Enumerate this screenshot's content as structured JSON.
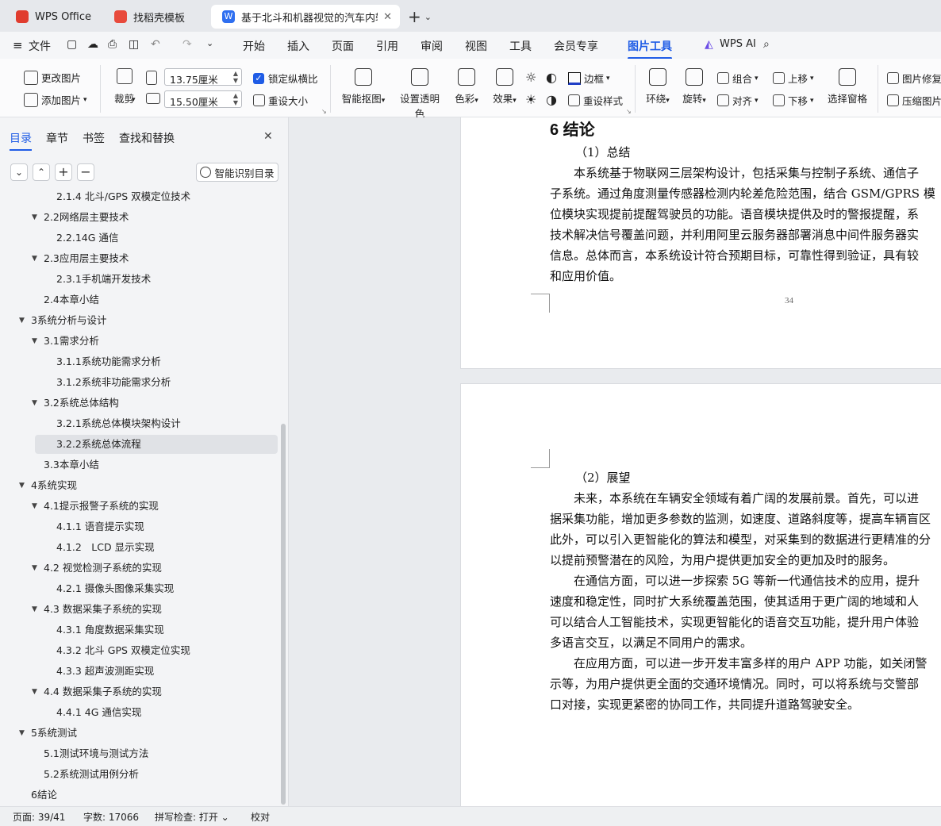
{
  "tabs": [
    {
      "label": "WPS Office"
    },
    {
      "label": "找稻壳模板"
    },
    {
      "label": "基于北斗和机器视觉的汽车内轮"
    }
  ],
  "menu": {
    "file": "文件",
    "items": [
      "开始",
      "插入",
      "页面",
      "引用",
      "审阅",
      "视图",
      "工具",
      "会员专享",
      "图片工具"
    ],
    "ai": "WPS AI"
  },
  "ribbon": {
    "change_pic": "更改图片",
    "add_pic": "添加图片",
    "crop": "裁剪",
    "width": "13.75厘米",
    "height": "15.50厘米",
    "lock_ratio": "锁定纵横比",
    "reset_size": "重设大小",
    "smart_cutout": "智能抠图",
    "set_transparent": "设置透明色",
    "color": "色彩",
    "effect": "效果",
    "border": "边框",
    "reset_style": "重设样式",
    "wrap": "环绕",
    "rotate": "旋转",
    "group": "组合",
    "align": "对齐",
    "bring_forward": "上移",
    "send_backward": "下移",
    "select_pane": "选择窗格",
    "repair": "图片修复",
    "compress": "压缩图片"
  },
  "sidebar": {
    "tabs": [
      "目录",
      "章节",
      "书签",
      "查找和替换"
    ],
    "smart_btn": "智能识别目录",
    "toc": [
      {
        "text": "2.1.4 北斗/GPS 双模定位技术",
        "level": 3,
        "arrow": ""
      },
      {
        "text": "2.2网络层主要技术",
        "level": 2,
        "arrow": "▼"
      },
      {
        "text": "2.2.14G 通信",
        "level": 3,
        "arrow": ""
      },
      {
        "text": "2.3应用层主要技术",
        "level": 2,
        "arrow": "▼"
      },
      {
        "text": "2.3.1手机端开发技术",
        "level": 3,
        "arrow": ""
      },
      {
        "text": "2.4本章小结",
        "level": 2,
        "arrow": ""
      },
      {
        "text": "3系统分析与设计",
        "level": 1,
        "arrow": "▼"
      },
      {
        "text": "3.1需求分析",
        "level": 2,
        "arrow": "▼"
      },
      {
        "text": "3.1.1系统功能需求分析",
        "level": 3,
        "arrow": ""
      },
      {
        "text": "3.1.2系统非功能需求分析",
        "level": 3,
        "arrow": ""
      },
      {
        "text": "3.2系统总体结构",
        "level": 2,
        "arrow": "▼"
      },
      {
        "text": "3.2.1系统总体模块架构设计",
        "level": 3,
        "arrow": ""
      },
      {
        "text": "3.2.2系统总体流程",
        "level": 3,
        "arrow": "",
        "selected": true
      },
      {
        "text": "3.3本章小结",
        "level": 2,
        "arrow": ""
      },
      {
        "text": "4系统实现",
        "level": 1,
        "arrow": "▼"
      },
      {
        "text": "4.1提示报警子系统的实现",
        "level": 2,
        "arrow": "▼"
      },
      {
        "text": "4.1.1 语音提示实现",
        "level": 3,
        "arrow": ""
      },
      {
        "text": "4.1.2　LCD 显示实现",
        "level": 3,
        "arrow": ""
      },
      {
        "text": "4.2 视觉检测子系统的实现",
        "level": 2,
        "arrow": "▼"
      },
      {
        "text": "4.2.1 摄像头图像采集实现",
        "level": 3,
        "arrow": ""
      },
      {
        "text": "4.3 数据采集子系统的实现",
        "level": 2,
        "arrow": "▼"
      },
      {
        "text": "4.3.1 角度数据采集实现",
        "level": 3,
        "arrow": ""
      },
      {
        "text": "4.3.2 北斗 GPS 双模定位实现",
        "level": 3,
        "arrow": ""
      },
      {
        "text": "4.3.3 超声波测距实现",
        "level": 3,
        "arrow": ""
      },
      {
        "text": "4.4 数据采集子系统的实现",
        "level": 2,
        "arrow": "▼"
      },
      {
        "text": "4.4.1 4G 通信实现",
        "level": 3,
        "arrow": ""
      },
      {
        "text": "5系统测试",
        "level": 1,
        "arrow": "▼"
      },
      {
        "text": "5.1测试环境与测试方法",
        "level": 2,
        "arrow": ""
      },
      {
        "text": "5.2系统测试用例分析",
        "level": 2,
        "arrow": ""
      },
      {
        "text": "6结论",
        "level": 1,
        "arrow": ""
      }
    ]
  },
  "doc": {
    "heading": "6  结论",
    "page_number": "34",
    "page1": [
      "（1）总结",
      "本系统基于物联网三层架构设计，包括采集与控制子系统、通信子",
      "子系统。通过角度测量传感器检测内轮差危险范围，结合 GSM/GPRS 模",
      "位模块实现提前提醒驾驶员的功能。语音模块提供及时的警报提醒，系",
      "技术解决信号覆盖问题，并利用阿里云服务器部署消息中间件服务器实",
      "信息。总体而言，本系统设计符合预期目标，可靠性得到验证，具有较",
      "和应用价值。"
    ],
    "page2": [
      "（2）展望",
      "未来，本系统在车辆安全领域有着广阔的发展前景。首先，可以进",
      "据采集功能，增加更多参数的监测，如速度、道路斜度等，提高车辆盲区",
      "此外，可以引入更智能化的算法和模型，对采集到的数据进行更精准的分",
      "以提前预警潜在的风险，为用户提供更加安全的更加及时的服务。",
      "在通信方面，可以进一步探索 5G 等新一代通信技术的应用，提升",
      "速度和稳定性，同时扩大系统覆盖范围，使其适用于更广阔的地域和人",
      "可以结合人工智能技术，实现更智能化的语音交互功能，提升用户体验",
      "多语言交互，以满足不同用户的需求。",
      "在应用方面，可以进一步开发丰富多样的用户 APP 功能，如关闭警",
      "示等，为用户提供更全面的交通环境情况。同时，可以将系统与交警部",
      "口对接，实现更紧密的协同工作，共同提升道路驾驶安全。"
    ]
  },
  "status": {
    "page": "页面: 39/41",
    "words": "字数: 17066",
    "spell": "拼写检查: 打开 ⌄",
    "proof": "校对"
  }
}
